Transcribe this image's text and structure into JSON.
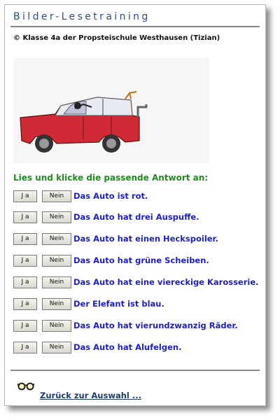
{
  "header": {
    "title": "Bilder-Lesetraining"
  },
  "credit": "© Klasse 4a der Propsteischule Westhausen (Tizian)",
  "instruction": "Lies und klicke die passende Antwort an:",
  "buttons": {
    "yes_label": "J a",
    "no_label": "Nein"
  },
  "questions": [
    {
      "text": "Das Auto ist rot."
    },
    {
      "text": "Das Auto hat drei Auspuffe."
    },
    {
      "text": "Das Auto hat einen Heckspoiler."
    },
    {
      "text": "Das Auto hat grüne Scheiben."
    },
    {
      "text": "Das Auto hat eine viereckige Karosserie."
    },
    {
      "text": "Der Elefant ist blau."
    },
    {
      "text": "Das Auto hat vierundzwanzig Räder."
    },
    {
      "text": "Das Auto hat Alufelgen."
    }
  ],
  "footer": {
    "back_link": "Zurück zur Auswahl ...",
    "icon": "glasses-icon"
  },
  "colors": {
    "title": "#2d4f82",
    "instruction": "#228b22",
    "statement": "#1f1fc8",
    "link": "#1e3d6b"
  }
}
